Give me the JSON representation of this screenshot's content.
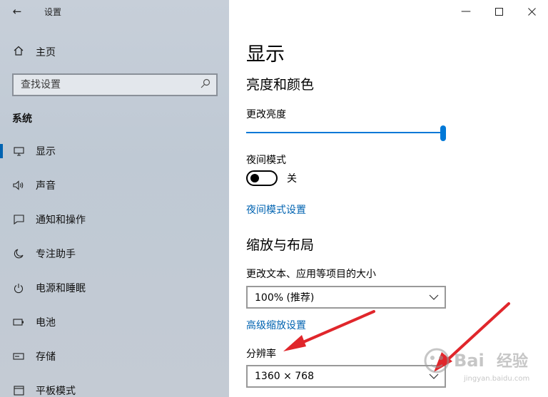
{
  "window": {
    "title": "设置"
  },
  "sidebar": {
    "home_label": "主页",
    "search_placeholder": "查找设置",
    "section_title": "系统",
    "items": [
      {
        "label": "显示",
        "icon": "monitor-icon",
        "active": true
      },
      {
        "label": "声音",
        "icon": "speaker-icon"
      },
      {
        "label": "通知和操作",
        "icon": "notification-icon"
      },
      {
        "label": "专注助手",
        "icon": "moon-icon"
      },
      {
        "label": "电源和睡眠",
        "icon": "power-icon"
      },
      {
        "label": "电池",
        "icon": "battery-icon"
      },
      {
        "label": "存储",
        "icon": "storage-icon"
      },
      {
        "label": "平板模式",
        "icon": "tablet-icon"
      }
    ]
  },
  "main": {
    "title": "显示",
    "brightness_section": "亮度和颜色",
    "brightness_label": "更改亮度",
    "brightness_value": 1.0,
    "night_mode_label": "夜间模式",
    "night_mode_state": "关",
    "night_mode_settings_link": "夜间模式设置",
    "scale_section": "缩放与布局",
    "scale_label": "更改文本、应用等项目的大小",
    "scale_value": "100% (推荐)",
    "advanced_scale_link": "高级缩放设置",
    "resolution_label": "分辨率",
    "resolution_value": "1360 × 768"
  },
  "colors": {
    "accent": "#0078d7",
    "link": "#0063b1",
    "annotation_arrow": "#e0262b"
  },
  "watermark": "Baidu 经验 jingyan.baidu.com"
}
